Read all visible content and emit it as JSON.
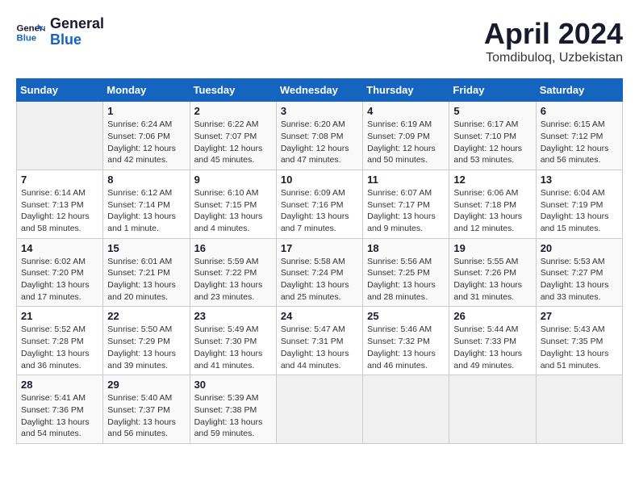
{
  "header": {
    "logo_line1": "General",
    "logo_line2": "Blue",
    "title": "April 2024",
    "subtitle": "Tomdibuloq, Uzbekistan"
  },
  "weekdays": [
    "Sunday",
    "Monday",
    "Tuesday",
    "Wednesday",
    "Thursday",
    "Friday",
    "Saturday"
  ],
  "weeks": [
    [
      {
        "num": "",
        "info": ""
      },
      {
        "num": "1",
        "info": "Sunrise: 6:24 AM\nSunset: 7:06 PM\nDaylight: 12 hours\nand 42 minutes."
      },
      {
        "num": "2",
        "info": "Sunrise: 6:22 AM\nSunset: 7:07 PM\nDaylight: 12 hours\nand 45 minutes."
      },
      {
        "num": "3",
        "info": "Sunrise: 6:20 AM\nSunset: 7:08 PM\nDaylight: 12 hours\nand 47 minutes."
      },
      {
        "num": "4",
        "info": "Sunrise: 6:19 AM\nSunset: 7:09 PM\nDaylight: 12 hours\nand 50 minutes."
      },
      {
        "num": "5",
        "info": "Sunrise: 6:17 AM\nSunset: 7:10 PM\nDaylight: 12 hours\nand 53 minutes."
      },
      {
        "num": "6",
        "info": "Sunrise: 6:15 AM\nSunset: 7:12 PM\nDaylight: 12 hours\nand 56 minutes."
      }
    ],
    [
      {
        "num": "7",
        "info": "Sunrise: 6:14 AM\nSunset: 7:13 PM\nDaylight: 12 hours\nand 58 minutes."
      },
      {
        "num": "8",
        "info": "Sunrise: 6:12 AM\nSunset: 7:14 PM\nDaylight: 13 hours\nand 1 minute."
      },
      {
        "num": "9",
        "info": "Sunrise: 6:10 AM\nSunset: 7:15 PM\nDaylight: 13 hours\nand 4 minutes."
      },
      {
        "num": "10",
        "info": "Sunrise: 6:09 AM\nSunset: 7:16 PM\nDaylight: 13 hours\nand 7 minutes."
      },
      {
        "num": "11",
        "info": "Sunrise: 6:07 AM\nSunset: 7:17 PM\nDaylight: 13 hours\nand 9 minutes."
      },
      {
        "num": "12",
        "info": "Sunrise: 6:06 AM\nSunset: 7:18 PM\nDaylight: 13 hours\nand 12 minutes."
      },
      {
        "num": "13",
        "info": "Sunrise: 6:04 AM\nSunset: 7:19 PM\nDaylight: 13 hours\nand 15 minutes."
      }
    ],
    [
      {
        "num": "14",
        "info": "Sunrise: 6:02 AM\nSunset: 7:20 PM\nDaylight: 13 hours\nand 17 minutes."
      },
      {
        "num": "15",
        "info": "Sunrise: 6:01 AM\nSunset: 7:21 PM\nDaylight: 13 hours\nand 20 minutes."
      },
      {
        "num": "16",
        "info": "Sunrise: 5:59 AM\nSunset: 7:22 PM\nDaylight: 13 hours\nand 23 minutes."
      },
      {
        "num": "17",
        "info": "Sunrise: 5:58 AM\nSunset: 7:24 PM\nDaylight: 13 hours\nand 25 minutes."
      },
      {
        "num": "18",
        "info": "Sunrise: 5:56 AM\nSunset: 7:25 PM\nDaylight: 13 hours\nand 28 minutes."
      },
      {
        "num": "19",
        "info": "Sunrise: 5:55 AM\nSunset: 7:26 PM\nDaylight: 13 hours\nand 31 minutes."
      },
      {
        "num": "20",
        "info": "Sunrise: 5:53 AM\nSunset: 7:27 PM\nDaylight: 13 hours\nand 33 minutes."
      }
    ],
    [
      {
        "num": "21",
        "info": "Sunrise: 5:52 AM\nSunset: 7:28 PM\nDaylight: 13 hours\nand 36 minutes."
      },
      {
        "num": "22",
        "info": "Sunrise: 5:50 AM\nSunset: 7:29 PM\nDaylight: 13 hours\nand 39 minutes."
      },
      {
        "num": "23",
        "info": "Sunrise: 5:49 AM\nSunset: 7:30 PM\nDaylight: 13 hours\nand 41 minutes."
      },
      {
        "num": "24",
        "info": "Sunrise: 5:47 AM\nSunset: 7:31 PM\nDaylight: 13 hours\nand 44 minutes."
      },
      {
        "num": "25",
        "info": "Sunrise: 5:46 AM\nSunset: 7:32 PM\nDaylight: 13 hours\nand 46 minutes."
      },
      {
        "num": "26",
        "info": "Sunrise: 5:44 AM\nSunset: 7:33 PM\nDaylight: 13 hours\nand 49 minutes."
      },
      {
        "num": "27",
        "info": "Sunrise: 5:43 AM\nSunset: 7:35 PM\nDaylight: 13 hours\nand 51 minutes."
      }
    ],
    [
      {
        "num": "28",
        "info": "Sunrise: 5:41 AM\nSunset: 7:36 PM\nDaylight: 13 hours\nand 54 minutes."
      },
      {
        "num": "29",
        "info": "Sunrise: 5:40 AM\nSunset: 7:37 PM\nDaylight: 13 hours\nand 56 minutes."
      },
      {
        "num": "30",
        "info": "Sunrise: 5:39 AM\nSunset: 7:38 PM\nDaylight: 13 hours\nand 59 minutes."
      },
      {
        "num": "",
        "info": ""
      },
      {
        "num": "",
        "info": ""
      },
      {
        "num": "",
        "info": ""
      },
      {
        "num": "",
        "info": ""
      }
    ]
  ]
}
